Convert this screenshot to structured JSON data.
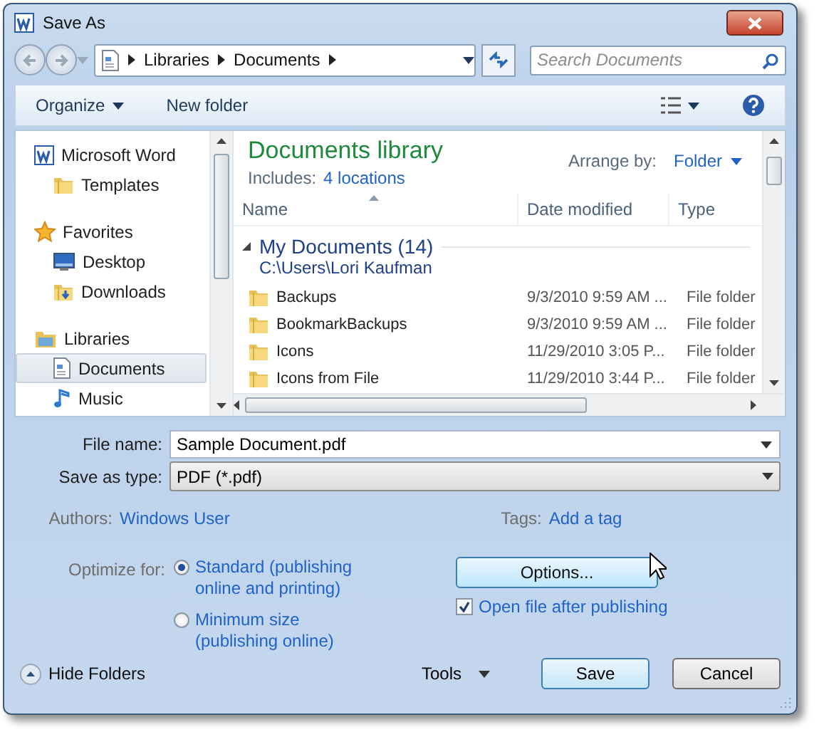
{
  "window": {
    "title": "Save As"
  },
  "address": {
    "path": [
      "Libraries",
      "Documents"
    ]
  },
  "search": {
    "placeholder": "Search Documents"
  },
  "toolbar": {
    "organize": "Organize",
    "new_folder": "New folder"
  },
  "sidebar": {
    "items": [
      {
        "label": "Microsoft Word",
        "kind": "word",
        "selected": false,
        "children": [
          {
            "label": "Templates",
            "kind": "folder",
            "selected": false
          }
        ]
      },
      {
        "label": "Favorites",
        "kind": "star",
        "selected": false,
        "children": [
          {
            "label": "Desktop",
            "kind": "desktop",
            "selected": false
          },
          {
            "label": "Downloads",
            "kind": "downloads",
            "selected": false
          }
        ]
      },
      {
        "label": "Libraries",
        "kind": "libraries",
        "selected": false,
        "children": [
          {
            "label": "Documents",
            "kind": "document",
            "selected": true
          },
          {
            "label": "Music",
            "kind": "music",
            "selected": false
          }
        ]
      }
    ]
  },
  "library": {
    "title": "Documents library",
    "includes_label": "Includes:",
    "includes_link": "4 locations",
    "arrange_label": "Arrange by:",
    "arrange_value": "Folder"
  },
  "table": {
    "columns": [
      "Name",
      "Date modified",
      "Type"
    ],
    "group": {
      "title": "My Documents (14)",
      "path": "C:\\Users\\Lori Kaufman",
      "expanded": true
    },
    "rows": [
      {
        "name": "Backups",
        "date": "9/3/2010 9:59 AM ...",
        "type": "File folder"
      },
      {
        "name": "BookmarkBackups",
        "date": "9/3/2010 9:59 AM ...",
        "type": "File folder"
      },
      {
        "name": "Icons",
        "date": "11/29/2010 3:05 P...",
        "type": "File folder"
      },
      {
        "name": "Icons from File",
        "date": "11/29/2010 3:44 P...",
        "type": "File folder"
      }
    ]
  },
  "form": {
    "file_name_label": "File name:",
    "file_name": "Sample Document.pdf",
    "type_label": "Save as type:",
    "type_value": "PDF (*.pdf)",
    "authors_label": "Authors:",
    "authors": "Windows User",
    "tags_label": "Tags:",
    "tags": "Add a tag",
    "optimize_label": "Optimize for:",
    "optimize_options": [
      {
        "label": "Standard (publishing online and printing)",
        "selected": true
      },
      {
        "label": "Minimum size (publishing online)",
        "selected": false
      }
    ],
    "options_button": "Options...",
    "open_after": {
      "label": "Open file after publishing",
      "checked": true
    }
  },
  "footer": {
    "hide_folders": "Hide Folders",
    "tools": "Tools",
    "save": "Save",
    "cancel": "Cancel"
  }
}
